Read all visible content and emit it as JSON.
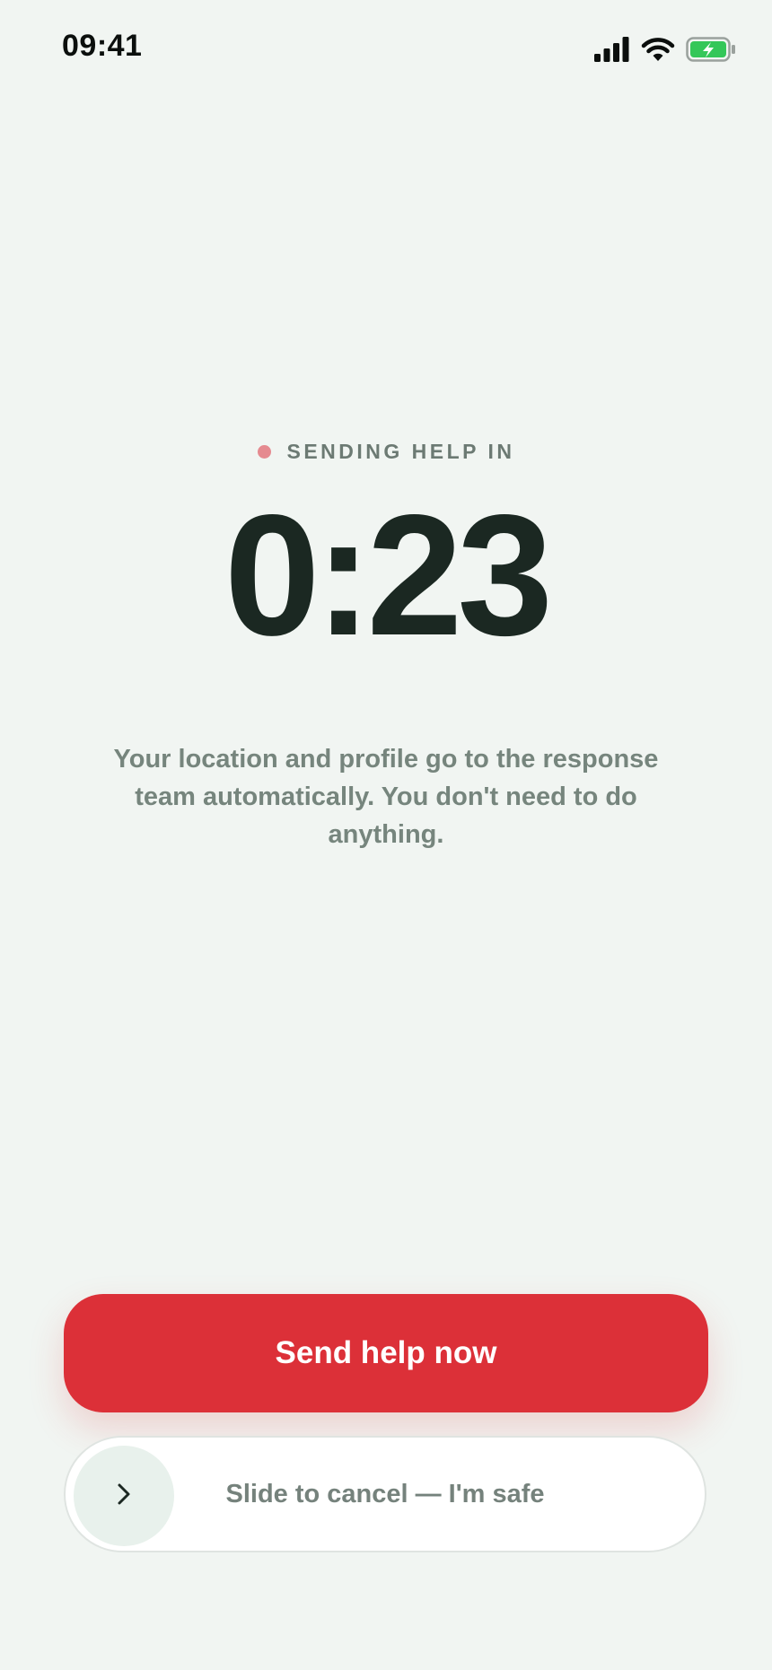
{
  "status_bar": {
    "time": "09:41",
    "icons": [
      "cellular-signal-icon",
      "wifi-icon",
      "battery-charging-icon"
    ],
    "battery_color": "#34c759"
  },
  "countdown_section": {
    "eyebrow": "SENDING HELP IN",
    "indicator_color": "#e58a90",
    "timer": "0:23",
    "description": "Your location and profile go to the response team automatically. You don't need to do anything."
  },
  "actions": {
    "send_now_label": "Send help now",
    "send_now_color": "#dc3038",
    "slider_label": "Slide to cancel — I'm safe",
    "slider_icon": "chevron-right-icon"
  }
}
